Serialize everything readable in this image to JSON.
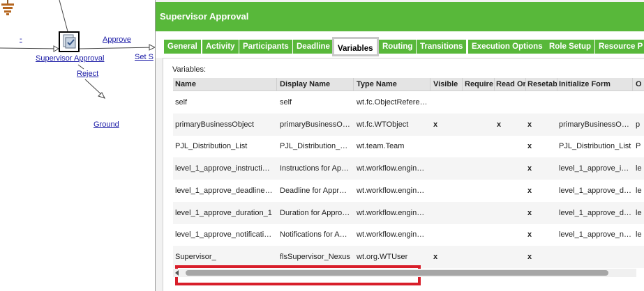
{
  "canvas": {
    "dash_label": "-",
    "task_label": "Supervisor Approval",
    "approve_label": "Approve",
    "reject_label": "Reject",
    "set_label": "Set S",
    "ground_label": "Ground"
  },
  "dialog": {
    "title": "Supervisor Approval",
    "tabs": [
      "General",
      "Activity",
      "Participants",
      "Deadline",
      "Variables",
      "Routing",
      "Transitions",
      "Execution Options",
      "Role Setup",
      "Resource P"
    ],
    "active_tab": "Variables",
    "section_label": "Variables:",
    "columns": [
      "Name",
      "Display Name",
      "Type Name",
      "Visible",
      "Require",
      "Read Or",
      "Resetab",
      "Initialize Form",
      "O"
    ],
    "rows": [
      {
        "name": "self",
        "display": "self",
        "type": "wt.fc.ObjectRefere…",
        "visible": "",
        "required": "",
        "readonly": "",
        "resetable": "",
        "init": "",
        "other": ""
      },
      {
        "name": "primaryBusinessObject",
        "display": "primaryBusinessO…",
        "type": "wt.fc.WTObject",
        "visible": "x",
        "required": "",
        "readonly": "x",
        "resetable": "x",
        "init": "primaryBusinessO…",
        "other": "p"
      },
      {
        "name": "PJL_Distribution_List",
        "display": "PJL_Distribution_List",
        "type": "wt.team.Team",
        "visible": "",
        "required": "",
        "readonly": "",
        "resetable": "x",
        "init": "PJL_Distribution_List",
        "other": "P"
      },
      {
        "name": "level_1_approve_instructio…",
        "display": "Instructions for App…",
        "type": "wt.workflow.engine…",
        "visible": "",
        "required": "",
        "readonly": "",
        "resetable": "x",
        "init": "level_1_approve_i…",
        "other": "le"
      },
      {
        "name": "level_1_approve_deadline_1",
        "display": "Deadline for Appro…",
        "type": "wt.workflow.engine…",
        "visible": "",
        "required": "",
        "readonly": "",
        "resetable": "x",
        "init": "level_1_approve_d…",
        "other": "le"
      },
      {
        "name": "level_1_approve_duration_1",
        "display": "Duration for Approv…",
        "type": "wt.workflow.engine…",
        "visible": "",
        "required": "",
        "readonly": "",
        "resetable": "x",
        "init": "level_1_approve_d…",
        "other": "le"
      },
      {
        "name": "level_1_approve_notificatio…",
        "display": "Notifications for Ap…",
        "type": "wt.workflow.engine…",
        "visible": "",
        "required": "",
        "readonly": "",
        "resetable": "x",
        "init": "level_1_approve_n…",
        "other": "le"
      },
      {
        "name": "Supervisor_",
        "display": "flsSupervisor_Nexus",
        "type": "wt.org.WTUser",
        "visible": "x",
        "required": "",
        "readonly": "",
        "resetable": "x",
        "init": "",
        "other": ""
      }
    ]
  },
  "colors": {
    "title_green": "#58b83a",
    "highlight_red": "#d81e2a",
    "link_blue": "#1a1aa6"
  }
}
